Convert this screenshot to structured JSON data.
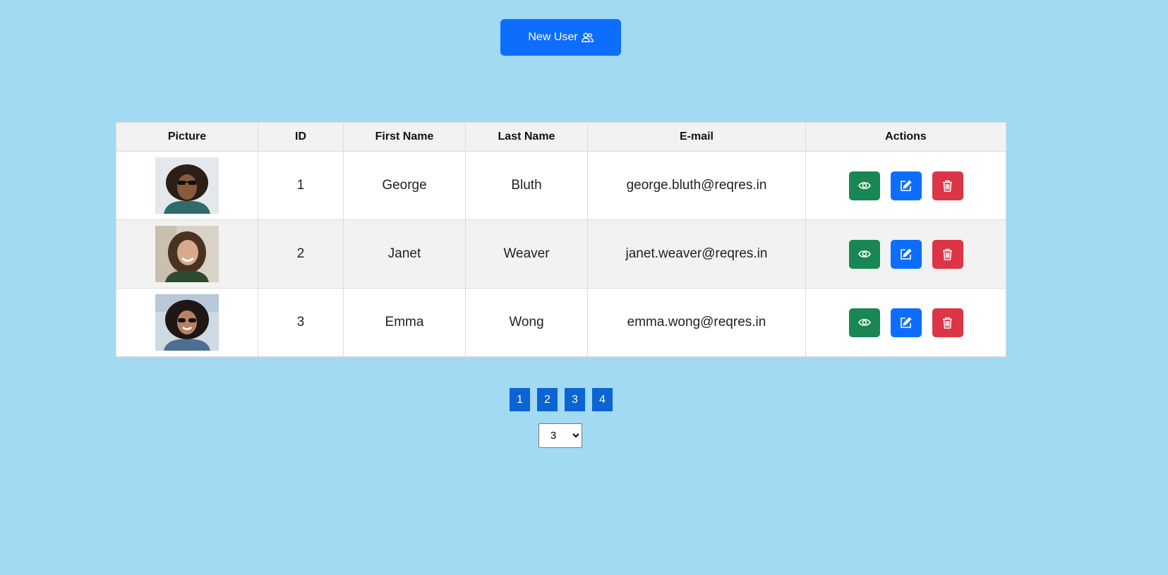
{
  "header": {
    "new_user_label": "New User",
    "new_user_icon": "users-icon"
  },
  "table": {
    "columns": [
      "Picture",
      "ID",
      "First Name",
      "Last Name",
      "E-mail",
      "Actions"
    ],
    "rows": [
      {
        "id": "1",
        "first_name": "George",
        "last_name": "Bluth",
        "email": "george.bluth@reqres.in",
        "picture": "avatar-photo"
      },
      {
        "id": "2",
        "first_name": "Janet",
        "last_name": "Weaver",
        "email": "janet.weaver@reqres.in",
        "picture": "avatar-photo"
      },
      {
        "id": "3",
        "first_name": "Emma",
        "last_name": "Wong",
        "email": "emma.wong@reqres.in",
        "picture": "avatar-photo"
      }
    ],
    "action_icons": [
      "eye-icon",
      "edit-icon",
      "trash-icon"
    ]
  },
  "pagination": {
    "pages": [
      "1",
      "2",
      "3",
      "4"
    ],
    "page_size_options": [
      "3"
    ],
    "page_size_selected": "3"
  },
  "colors": {
    "background": "#a2daf4",
    "primary": "#0d6efd",
    "success": "#198754",
    "danger": "#dc3545",
    "page_button": "#0b63d4"
  }
}
